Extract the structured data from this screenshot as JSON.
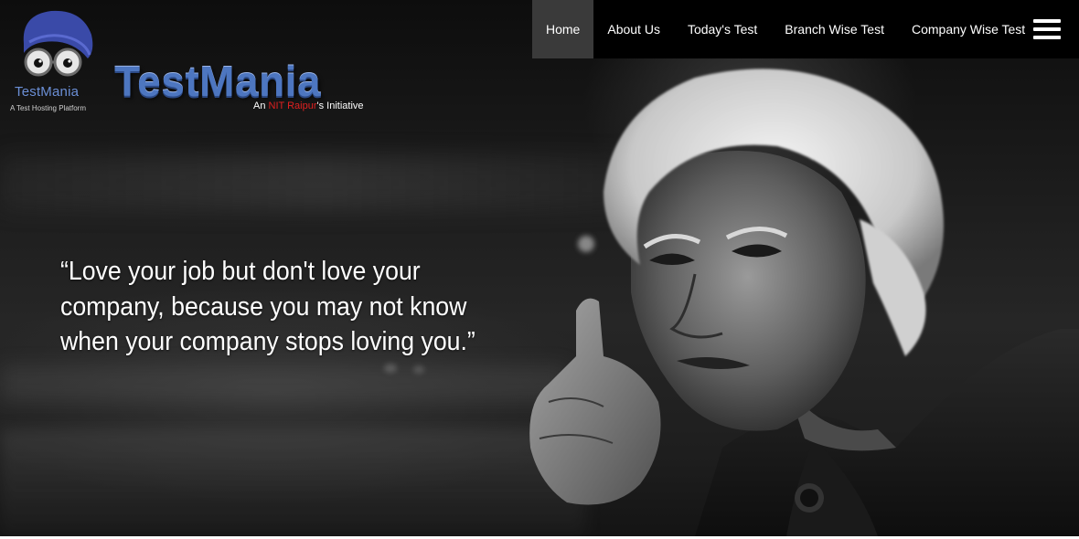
{
  "nav": {
    "items": [
      {
        "label": "Home",
        "active": true
      },
      {
        "label": "About Us",
        "active": false
      },
      {
        "label": "Today's Test",
        "active": false
      },
      {
        "label": "Branch Wise Test",
        "active": false
      },
      {
        "label": "Company Wise Test",
        "active": false
      }
    ],
    "menu_icon": "hamburger-menu-icon"
  },
  "logo": {
    "mark_text": "TestMania",
    "mark_tagline": "A Test Hosting Platform",
    "title": "TestMania",
    "subtitle_prefix": "An ",
    "subtitle_highlight": "NIT Raipur",
    "subtitle_suffix": "'s Initiative"
  },
  "hero": {
    "quote": "“Love your job but don't love your company, because you may not know when your company stops loving you.”"
  },
  "colors": {
    "nav_bg": "#000000",
    "nav_active_bg": "#3a3a3a",
    "brand_blue": "#4d76c0",
    "highlight_red": "#e02020"
  }
}
